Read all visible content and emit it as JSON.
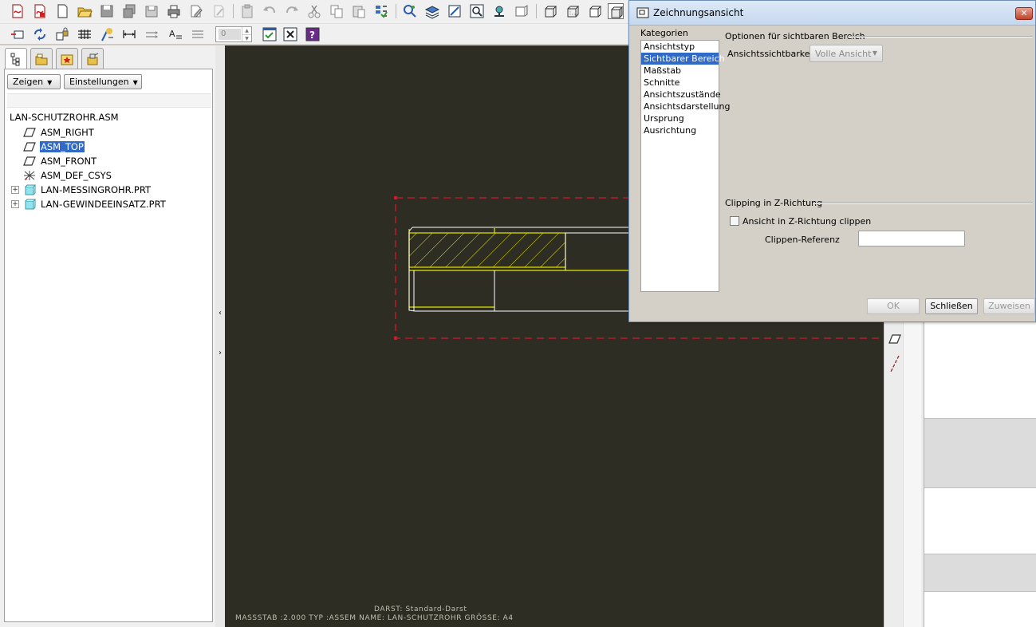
{
  "toolbar": {
    "icons_row1": [
      "new-drawing-icon",
      "pdf-icon",
      "new-file-icon",
      "open-folder-icon",
      "save-icon",
      "save-copy-icon",
      "backup-icon",
      "print-icon",
      "edit-icon",
      "disabled-icon",
      "paste-icon",
      "undo-icon",
      "redo-icon",
      "cut-icon",
      "copy-icon",
      "paste-special-icon",
      "regenerate-icon",
      "repaint-icon",
      "layers-icon",
      "view-icon",
      "zoom-icon",
      "saved-views-icon",
      "orient-icon",
      "wireframe-icon",
      "hidden-line-icon",
      "no-hidden-icon",
      "shading-icon"
    ],
    "spinner_value": "0"
  },
  "model_tree": {
    "show_button": "Zeigen",
    "settings_button": "Einstellungen",
    "root": "LAN-SCHUTZROHR.ASM",
    "items": [
      {
        "label": "ASM_RIGHT",
        "icon": "datum-plane-icon",
        "expandable": false,
        "selected": false
      },
      {
        "label": "ASM_TOP",
        "icon": "datum-plane-icon",
        "expandable": false,
        "selected": true
      },
      {
        "label": "ASM_FRONT",
        "icon": "datum-plane-icon",
        "expandable": false,
        "selected": false
      },
      {
        "label": "ASM_DEF_CSYS",
        "icon": "coordinate-system-icon",
        "expandable": false,
        "selected": false
      },
      {
        "label": "LAN-MESSINGROHR.PRT",
        "icon": "part-icon",
        "expandable": true,
        "selected": false
      },
      {
        "label": "LAN-GEWINDEEINSATZ.PRT",
        "icon": "part-icon",
        "expandable": true,
        "selected": false
      }
    ]
  },
  "status": {
    "line1": "DARST: Standard-Darst",
    "line2": "MASSSTAB :2.000    TYP :ASSEM    NAME: LAN-SCHUTZROHR    GRÖSSE: A4"
  },
  "colors": {
    "canvas": "#2e2d24",
    "geometry": "#ffffff",
    "section": "#e6e600",
    "border": "#d01a2a"
  },
  "dialog": {
    "title": "Zeichnungsansicht",
    "categories_label": "Kategorien",
    "categories": [
      {
        "label": "Ansichtstyp",
        "selected": false
      },
      {
        "label": "Sichtbarer Bereich",
        "selected": true
      },
      {
        "label": "Maßstab",
        "selected": false
      },
      {
        "label": "Schnitte",
        "selected": false
      },
      {
        "label": "Ansichtszustände",
        "selected": false
      },
      {
        "label": "Ansichtsdarstellung",
        "selected": false
      },
      {
        "label": "Ursprung",
        "selected": false
      },
      {
        "label": "Ausrichtung",
        "selected": false
      }
    ],
    "visible_area_group": "Optionen für sichtbaren Bereich",
    "visibility_label": "Ansichtssichtbarkeit",
    "visibility_value": "Volle Ansicht",
    "clipping_group": "Clipping in Z-Richtung",
    "clip_checkbox_label": "Ansicht in Z-Richtung clippen",
    "clip_checkbox_checked": false,
    "clip_ref_label": "Clippen-Referenz",
    "clip_ref_value": "",
    "ok_button": "OK",
    "close_button": "Schließen",
    "apply_button": "Zuweisen"
  }
}
